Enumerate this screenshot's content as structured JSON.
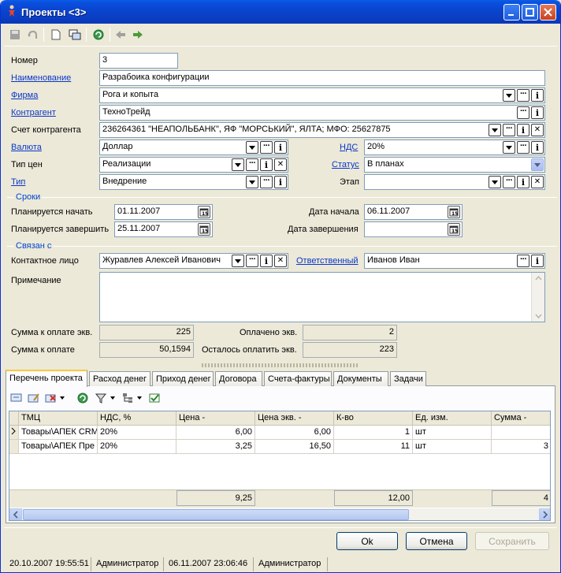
{
  "window": {
    "title": "Проекты <3>"
  },
  "form": {
    "number_label": "Номер",
    "number_value": "3",
    "name_label": "Наименование",
    "name_value": "Разрабоика конфигурации",
    "firm_label": "Фирма",
    "firm_value": "Рога и копыта",
    "contractor_label": "Контрагент",
    "contractor_value": "ТехноТрейд",
    "account_label": "Счет контрагента",
    "account_value": "236264361  \"НЕАПОЛЬБАНК\", ЯФ \"МОРСЬКИЙ\", ЯЛТА; МФО: 25627875",
    "currency_label": "Валюта",
    "currency_value": "Доллар",
    "vat_label": "НДС",
    "vat_value": "20%",
    "price_type_label": "Тип цен",
    "price_type_value": "Реализации",
    "status_label": "Статус",
    "status_value": "В планах",
    "type_label": "Тип",
    "type_value": "Внедрение",
    "stage_label": "Этап",
    "stage_value": ""
  },
  "terms": {
    "title": "Сроки",
    "plan_start_label": "Планируется начать",
    "plan_start_value": "01.11.2007",
    "plan_end_label": "Планируется завершить",
    "plan_end_value": "25.11.2007",
    "start_label": "Дата начала",
    "start_value": "06.11.2007",
    "end_label": "Дата завершения",
    "end_value": ""
  },
  "linked": {
    "title": "Связан с",
    "contact_label": "Контактное лицо",
    "contact_value": "Журавлев Алексей Иванович",
    "responsible_label": "Ответственный",
    "responsible_value": "Иванов Иван",
    "note_label": "Примечание",
    "note_value": ""
  },
  "sums": {
    "sum_eq_label": "Сумма к оплате экв.",
    "sum_eq_value": "225",
    "paid_eq_label": "Оплачено экв.",
    "paid_eq_value": "2",
    "sum_label": "Сумма к оплате",
    "sum_value": "50,1594",
    "left_eq_label": "Осталось оплатить экв.",
    "left_eq_value": "223"
  },
  "tabs": [
    "Перечень проекта",
    "Расход денег",
    "Приход денег",
    "Договора",
    "Счета-фактуры",
    "Документы",
    "Задачи"
  ],
  "grid": {
    "columns": [
      "ТМЦ",
      "НДС, %",
      "Цена -",
      "Цена экв. -",
      "К-во",
      "Ед. изм.",
      "Сумма -"
    ],
    "rows": [
      [
        "Товары\\АПЕК CRM",
        "20%",
        "6,00",
        "6,00",
        "1",
        "шт",
        ""
      ],
      [
        "Товары\\АПЕК Пре",
        "20%",
        "3,25",
        "16,50",
        "11",
        "шт",
        "3"
      ]
    ],
    "totals": {
      "price": "9,25",
      "qty": "12,00",
      "sum": "4"
    }
  },
  "buttons": {
    "ok": "Ok",
    "cancel": "Отмена",
    "save": "Сохранить"
  },
  "status": [
    "20.10.2007 19:55:51",
    "Администратор",
    "06.11.2007 23:06:46",
    "Администратор"
  ]
}
